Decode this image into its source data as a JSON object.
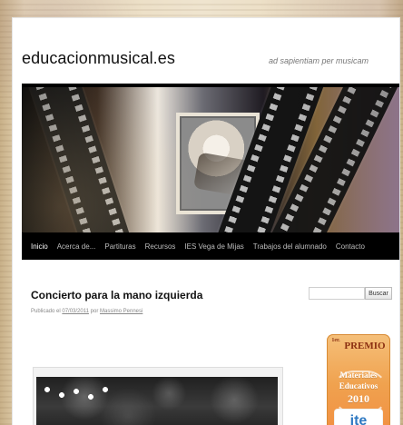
{
  "site": {
    "title": "educacionmusical.es",
    "tagline": "ad sapientiam per musicam"
  },
  "nav": {
    "items": [
      {
        "label": "Inicio"
      },
      {
        "label": "Acerca de..."
      },
      {
        "label": "Partituras"
      },
      {
        "label": "Recursos"
      },
      {
        "label": "IES Vega de Mijas"
      },
      {
        "label": "Trabajos del alumnado"
      },
      {
        "label": "Contacto"
      }
    ]
  },
  "post": {
    "title": "Concierto para la mano izquierda",
    "meta_prefix": "Publicado el",
    "date": "07/03/2011",
    "by": "por",
    "author": "Massimo Pennesi"
  },
  "sidebar": {
    "search": {
      "placeholder": "",
      "button_label": "Buscar"
    },
    "award": {
      "line0_sup": "1er.",
      "line0": "PREMIO",
      "line1": "Materiales",
      "line2": "Educativos",
      "line3": "2010",
      "brand": "ite"
    }
  }
}
